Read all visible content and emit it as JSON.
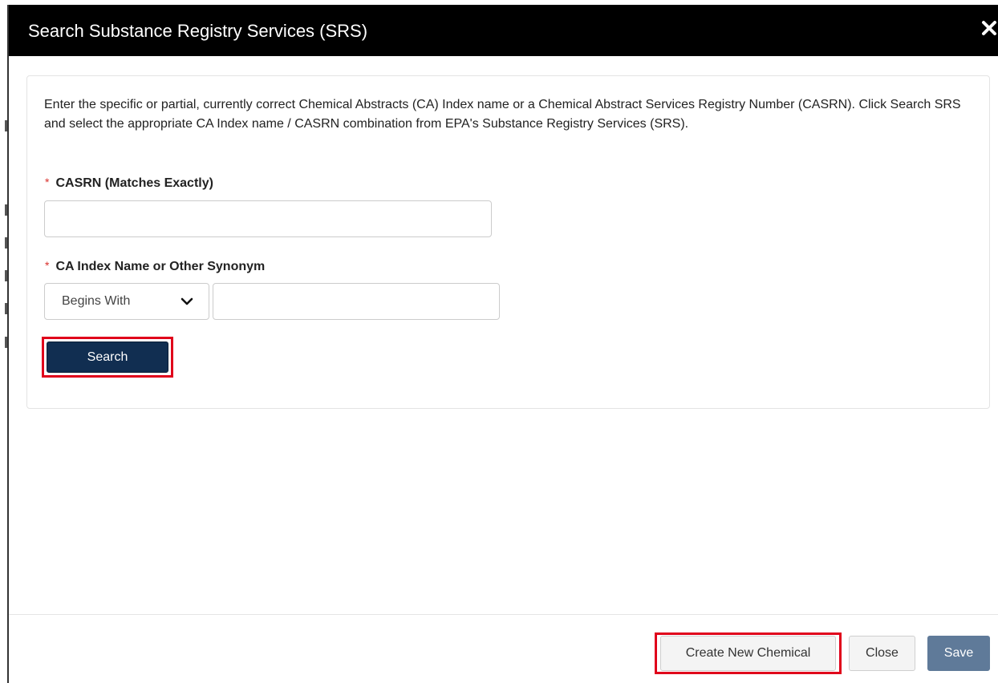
{
  "dialog": {
    "title": "Search Substance Registry Services (SRS)",
    "close_icon": "close-icon"
  },
  "form": {
    "instructions": "Enter the specific or partial, currently correct Chemical Abstracts (CA) Index name or a Chemical Abstract Services Registry Number (CASRN). Click Search SRS and select the appropriate CA Index name / CASRN combination from EPA's Substance Registry Services (SRS).",
    "required_marker": "*",
    "casrn": {
      "label": "CASRN (Matches Exactly)",
      "value": ""
    },
    "ca_index_name": {
      "label": "CA Index Name or Other Synonym",
      "match_mode": "Begins With",
      "value": ""
    },
    "search_label": "Search"
  },
  "footer": {
    "create_label": "Create New Chemical",
    "close_label": "Close",
    "save_label": "Save"
  },
  "colors": {
    "header_bg": "#000000",
    "search_button": "#112e51",
    "save_button": "#5f7a99",
    "highlight_outline": "#e0001b",
    "required_star": "#d9302c"
  }
}
